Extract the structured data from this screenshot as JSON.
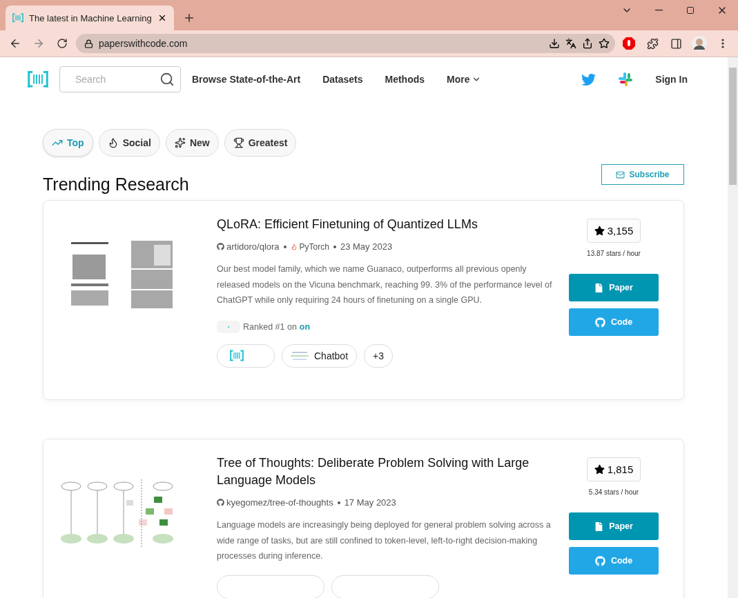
{
  "browser": {
    "tab_title": "The latest in Machine Learning",
    "url": "paperswithcode.com"
  },
  "nav": {
    "search_placeholder": "Search",
    "links": [
      "Browse State-of-the-Art",
      "Datasets",
      "Methods",
      "More"
    ],
    "sign_in": "Sign In"
  },
  "filters": [
    {
      "label": "Top",
      "kind": "top",
      "selected": true
    },
    {
      "label": "Social",
      "kind": "social",
      "selected": false
    },
    {
      "label": "New",
      "kind": "new",
      "selected": false
    },
    {
      "label": "Greatest",
      "kind": "greatest",
      "selected": false
    }
  ],
  "heading": "Trending Research",
  "subscribe": "Subscribe",
  "papers": [
    {
      "title": "QLoRA: Efficient Finetuning of Quantized LLMs",
      "repo": "artidoro/qlora",
      "framework": "PyTorch",
      "date": "23 May 2023",
      "abstract": "Our best model family, which we name Guanaco, outperforms all previous openly released models on the Vicuna benchmark, reaching 99. 3% of the performance level of ChatGPT while only requiring 24 hours of finetuning on a single GPU.",
      "ranked": {
        "text": "Ranked #1 on",
        "link": "on"
      },
      "tags": [
        {
          "kind": "logo"
        },
        {
          "kind": "picture",
          "label": "Chatbot"
        },
        {
          "kind": "count",
          "label": "+3"
        }
      ],
      "stars": "3,155",
      "rate": "13.87 stars / hour",
      "paper": "Paper",
      "code": "Code"
    },
    {
      "title": "Tree of Thoughts: Deliberate Problem Solving with Large Language Models",
      "repo": "kyegomez/tree-of-thoughts",
      "date": "17 May 2023",
      "abstract": "Language models are increasingly being deployed for general problem solving across a wide range of tasks, but are still confined to token-level, left-to-right decision-making processes during inference.",
      "tags": [
        {
          "kind": "blank"
        },
        {
          "kind": "blank"
        }
      ],
      "stars": "1,815",
      "rate": "5.34 stars / hour",
      "paper": "Paper",
      "code": "Code"
    }
  ]
}
